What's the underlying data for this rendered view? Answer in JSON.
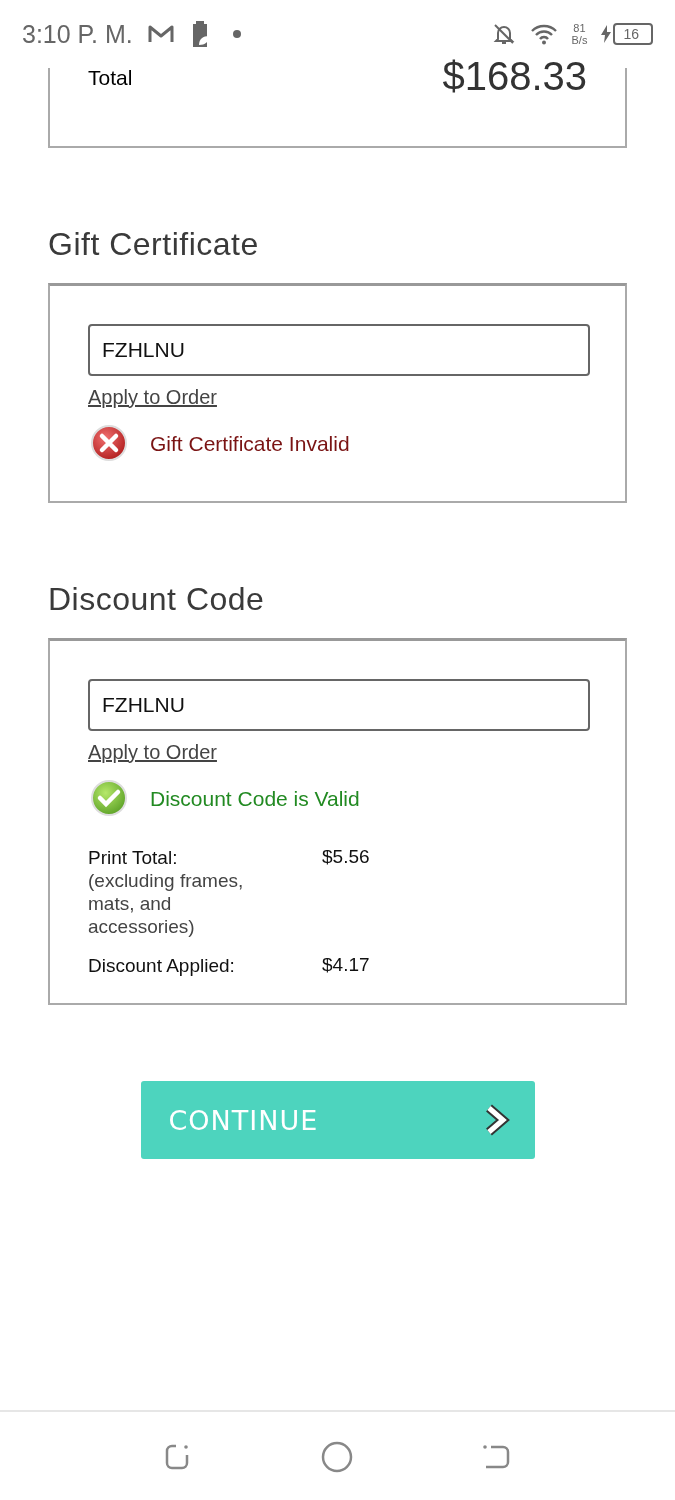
{
  "status_bar": {
    "time": "3:10 P. M.",
    "net_speed": "81",
    "net_unit": "B/s",
    "battery": "16"
  },
  "order_summary": {
    "label": "Total",
    "amount": "$168.33"
  },
  "sections": [
    {
      "title": "Gift Certificate",
      "code": "FZHLNU",
      "link": "Apply to Order",
      "message": {
        "kind": "error",
        "text": "Gift Certificate Invalid"
      }
    },
    {
      "title": "Discount Code",
      "code": "FZHLNU",
      "link": "Apply to Order",
      "message": {
        "kind": "success",
        "text": "Discount Code is Valid"
      },
      "details": [
        {
          "label": "Print Total:",
          "note": "(excluding frames, mats, and accessories)",
          "value": "$5.56"
        },
        {
          "label": "Discount Applied:",
          "value": "$4.17"
        }
      ]
    }
  ],
  "continue_button": {
    "label": "CONTINUE"
  }
}
